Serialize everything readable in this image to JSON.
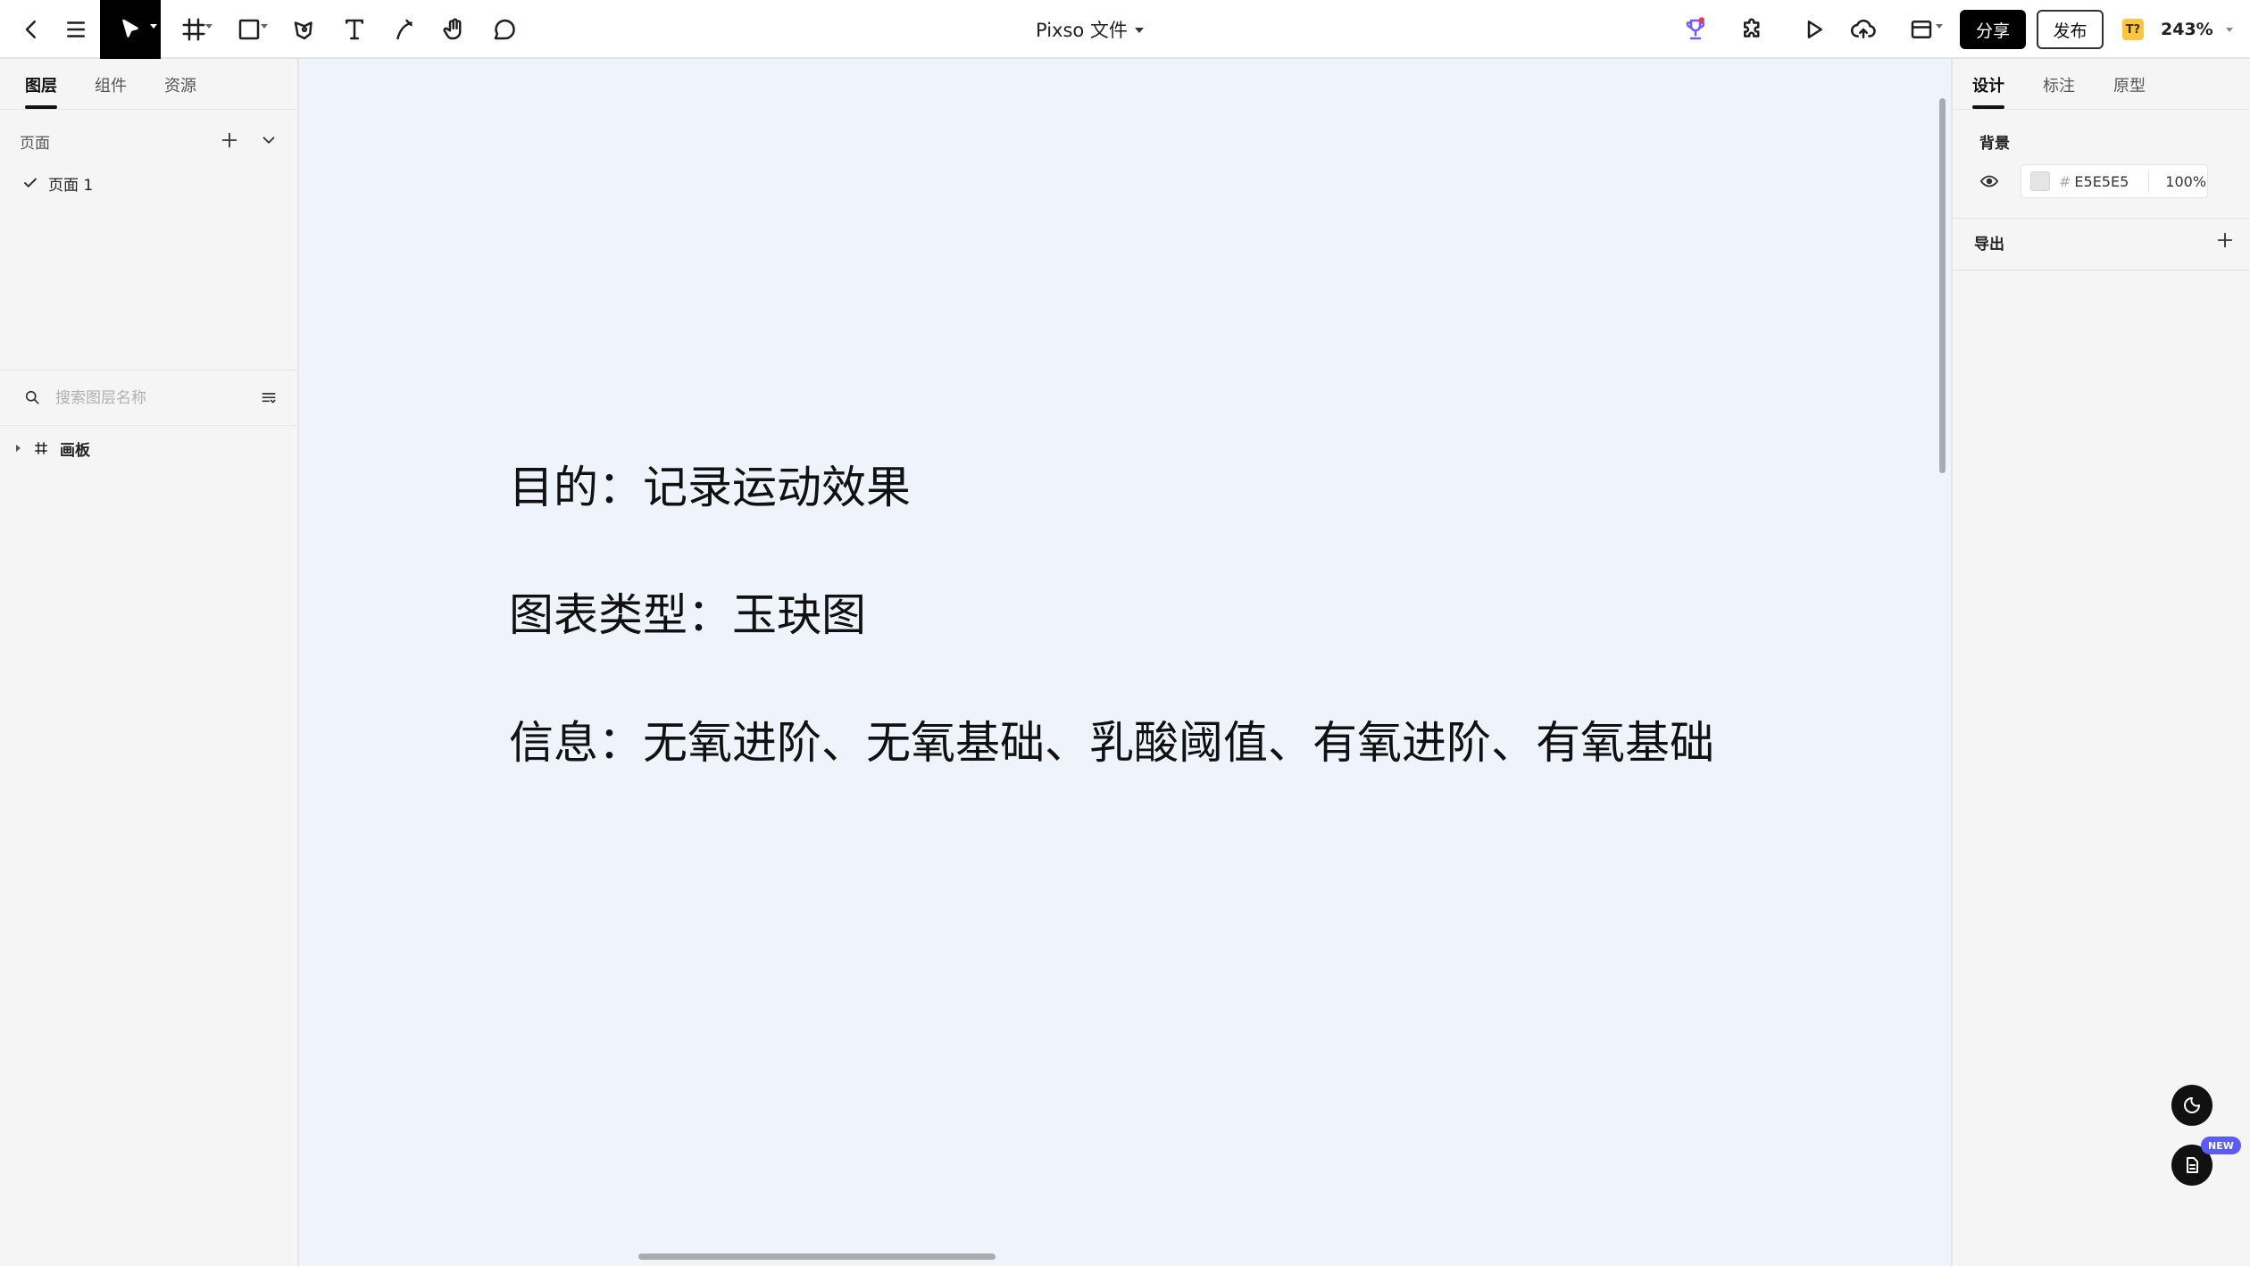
{
  "toolbar": {
    "file_title": "Pixso 文件",
    "share_label": "分享",
    "publish_label": "发布",
    "ai_badge": "T?",
    "zoom": "243%",
    "icons": [
      "back-icon",
      "menu-icon",
      "move-icon",
      "frame-icon",
      "rectangle-icon",
      "pen-icon",
      "text-icon",
      "pencil-icon",
      "hand-icon",
      "comment-icon",
      "plugin-icon",
      "play-icon",
      "cloud-upload-icon",
      "layout-icon",
      "trophy-icon"
    ]
  },
  "left_panel": {
    "tabs": [
      {
        "label": "图层",
        "active": true
      },
      {
        "label": "组件",
        "active": false
      },
      {
        "label": "资源",
        "active": false
      }
    ],
    "pages_label": "页面",
    "pages": [
      {
        "label": "页面 1",
        "selected": true
      }
    ],
    "search_placeholder": "搜索图层名称",
    "layers": [
      {
        "label": "画板",
        "type": "frame"
      }
    ]
  },
  "canvas": {
    "background": "#eff3fc",
    "texts": [
      "目的：记录运动效果",
      "图表类型：玉玦图",
      "信息：无氧进阶、无氧基础、乳酸阈值、有氧进阶、有氧基础"
    ]
  },
  "right_panel": {
    "tabs": [
      {
        "label": "设计",
        "active": true
      },
      {
        "label": "标注",
        "active": false
      },
      {
        "label": "原型",
        "active": false
      }
    ],
    "background_label": "背景",
    "background_hash": "#",
    "background_hex": "E5E5E5",
    "background_swatch": "#E5E5E5",
    "background_opacity": "100%",
    "export_label": "导出"
  },
  "floating": {
    "new_badge": "NEW"
  }
}
